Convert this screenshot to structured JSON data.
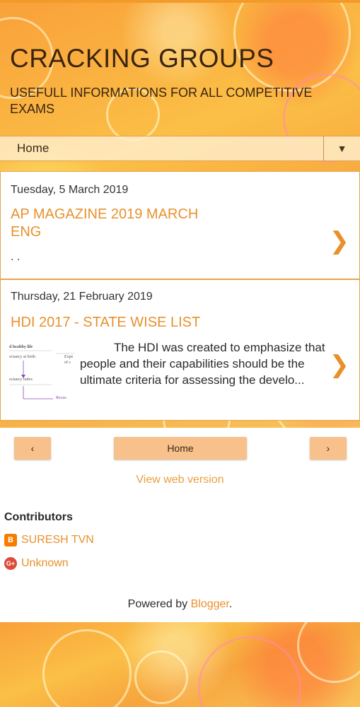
{
  "header": {
    "title": "CRACKING GROUPS",
    "description": "USEFULL INFORMATIONS FOR ALL COMPETITIVE EXAMS"
  },
  "nav": {
    "home_label": "Home",
    "dropdown_icon": "▼"
  },
  "posts": [
    {
      "date": "Tuesday, 5 March 2019",
      "title": "AP MAGAZINE 2019 MARCH ENG",
      "snippet": ". .",
      "chevron": "❯"
    },
    {
      "date": "Thursday, 21 February 2019",
      "title": "HDI 2017 - STATE WISE LIST",
      "snippet": "The HDI was created to emphasize that people and their capabilities should be the ultimate criteria for assessing the develo...",
      "chevron": "❯",
      "thumb_lines": [
        "d healthy life",
        "Expe",
        "of s",
        "ectancy at birth",
        "ectancy index",
        "Recus"
      ]
    }
  ],
  "pager": {
    "prev": "‹",
    "home": "Home",
    "next": "›"
  },
  "view_web": "View web version",
  "contributors": {
    "title": "Contributors",
    "items": [
      {
        "name": "SURESH TVN",
        "icon": "blogger-icon",
        "color": "#f57d00",
        "glyph": "B"
      },
      {
        "name": "Unknown",
        "icon": "google-plus-icon",
        "color": "#dd4b39",
        "glyph": "G+"
      }
    ]
  },
  "footer": {
    "powered_prefix": "Powered by ",
    "powered_link": "Blogger",
    "powered_suffix": "."
  },
  "colors": {
    "accent": "#e8912c",
    "button": "#f8c08a"
  }
}
